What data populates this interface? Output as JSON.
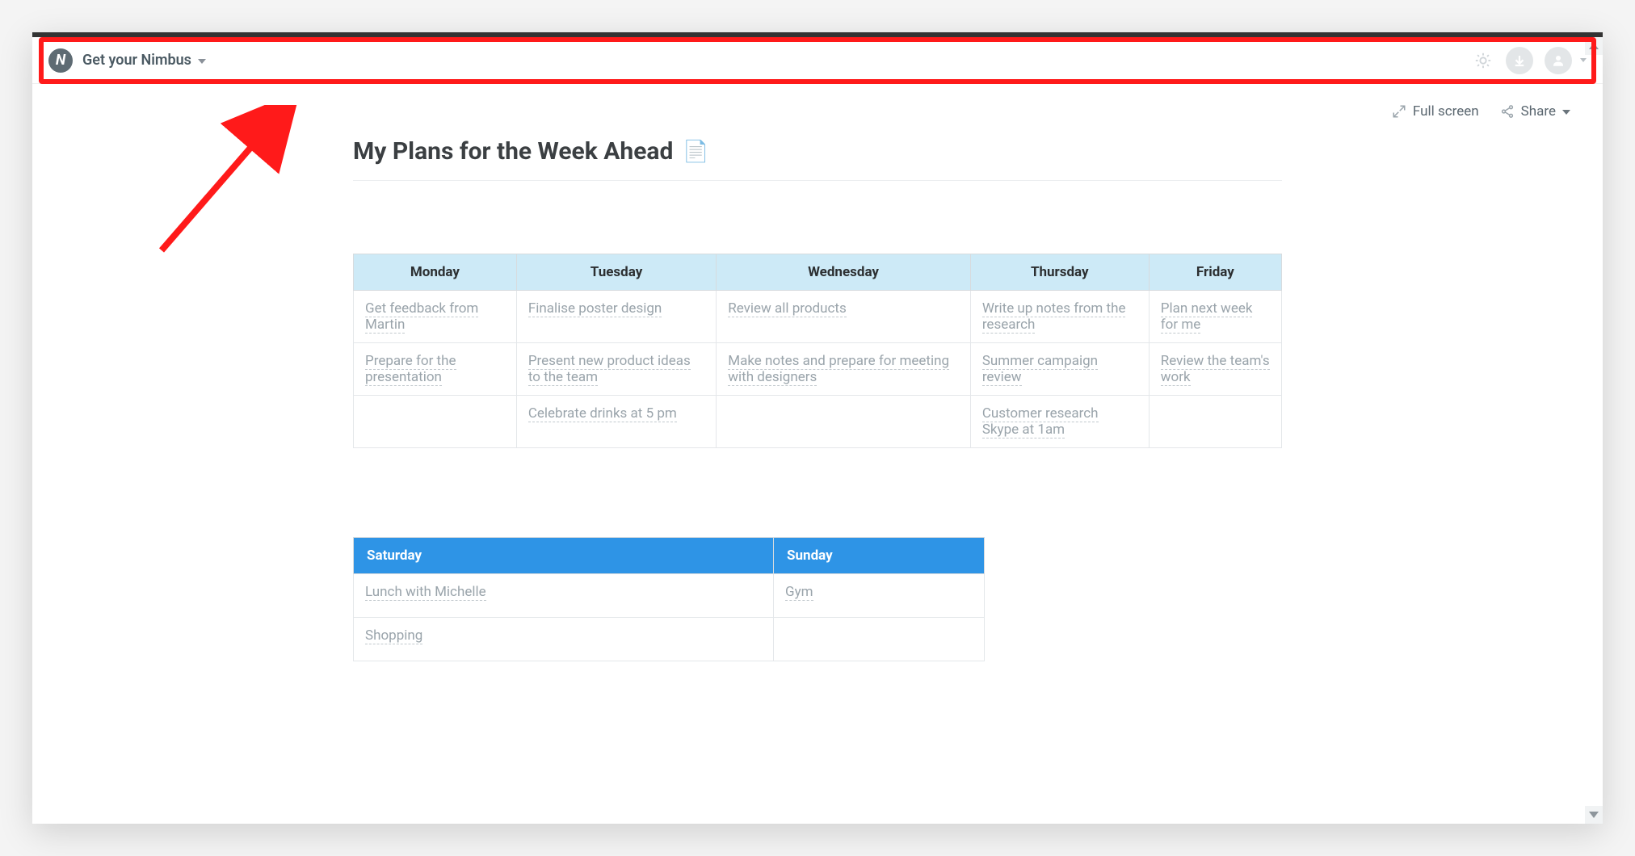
{
  "header": {
    "brand_label": "Get your Nimbus",
    "logo_letter": "N"
  },
  "subheader": {
    "fullscreen_label": "Full screen",
    "share_label": "Share"
  },
  "page": {
    "title": "My Plans for the Week Ahead",
    "title_emoji": "📄"
  },
  "weekday_table": {
    "headers": [
      "Monday",
      "Tuesday",
      "Wednesday",
      "Thursday",
      "Friday"
    ],
    "rows": [
      [
        "Get feedback from Martin",
        "Finalise poster design",
        "Review all products",
        "Write up notes from the research",
        "Plan next week for me"
      ],
      [
        "Prepare for the presentation",
        "Present new product ideas to the team",
        "Make notes and prepare for meeting with designers",
        "Summer campaign review",
        "Review the team's work"
      ],
      [
        "",
        "Celebrate drinks at 5 pm",
        "",
        "Customer research Skype at 1am",
        ""
      ]
    ]
  },
  "weekend_table": {
    "headers": [
      "Saturday",
      "Sunday"
    ],
    "rows": [
      [
        "Lunch with Michelle",
        "Gym"
      ],
      [
        "Shopping",
        ""
      ]
    ]
  }
}
